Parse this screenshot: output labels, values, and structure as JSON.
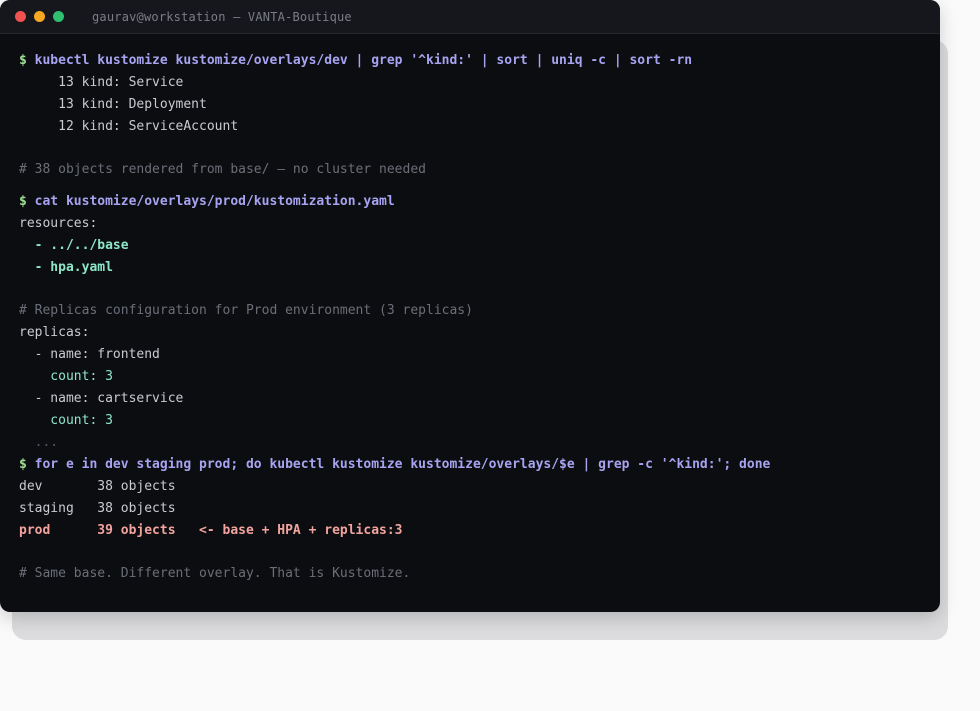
{
  "window": {
    "title": "gaurav@workstation — VANTA-Boutique",
    "traffic_lights": {
      "close": "#f0524f",
      "minimize": "#f5a623",
      "maximize": "#2fbf71"
    }
  },
  "terminal": {
    "prompt": "$",
    "cmd1": "kubectl kustomize kustomize/overlays/dev | grep '^kind:' | sort | uniq -c | sort -rn",
    "kinds": [
      "     13 kind: Service",
      "     13 kind: Deployment",
      "     12 kind: ServiceAccount"
    ],
    "comment1": "# 38 objects rendered from base/ — no cluster needed",
    "cmd2": "cat kustomize/overlays/prod/kustomization.yaml",
    "resources_key": "resources:",
    "resources": [
      "  - ../../base",
      "  - hpa.yaml"
    ],
    "comment2": "# Replicas configuration for Prod environment (3 replicas)",
    "replicas_key": "replicas:",
    "replica_items": [
      {
        "name": "  - name: frontend",
        "count": "    count: 3"
      },
      {
        "name": "  - name: cartservice",
        "count": "    count: 3"
      }
    ],
    "ellipsis": "  ...",
    "cmd3": "for e in dev staging prod; do kubectl kustomize kustomize/overlays/$e | grep -c '^kind:'; done",
    "env_counts": [
      "dev       38 objects",
      "staging   38 objects"
    ],
    "prod_count": "prod      39 objects   <- base + HPA + replicas:3",
    "comment3": "# Same base. Different overlay. That is Kustomize."
  }
}
